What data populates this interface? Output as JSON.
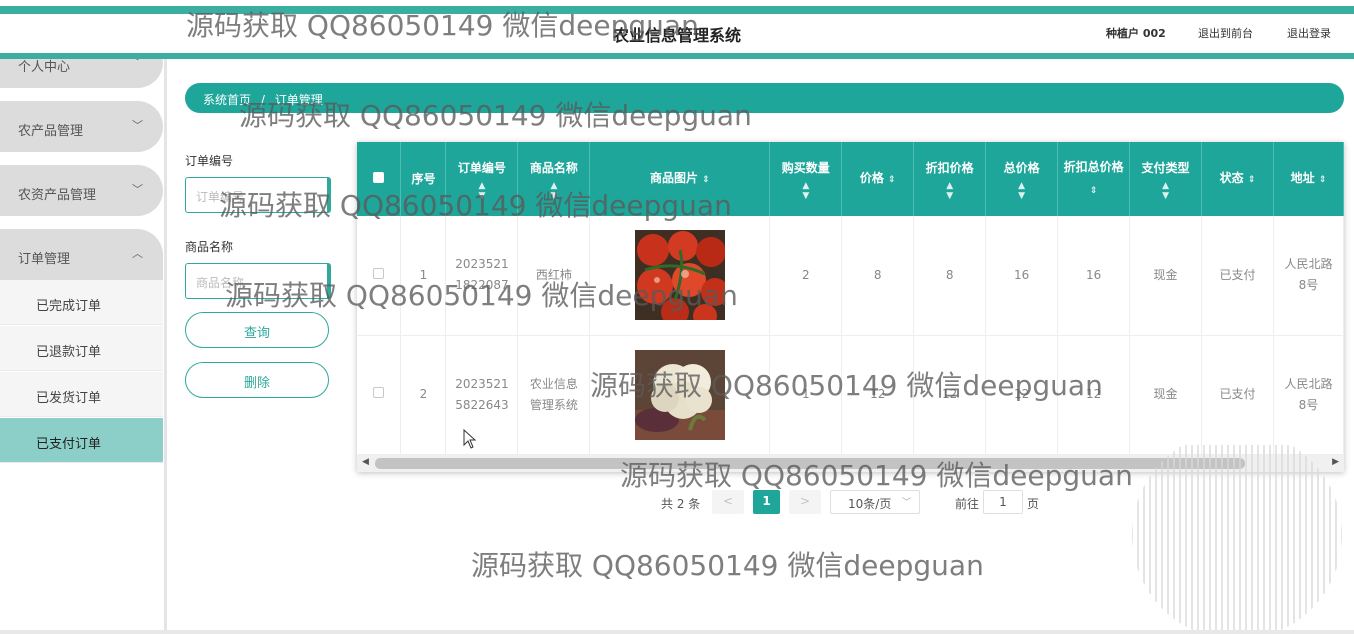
{
  "header": {
    "title": "农业信息管理系统",
    "user": "种植户 002",
    "links": [
      "退出到前台",
      "退出登录"
    ]
  },
  "sidebar": {
    "items": [
      {
        "label": "个人中心",
        "expanded": false
      },
      {
        "label": "农产品管理",
        "expanded": false
      },
      {
        "label": "农资产品管理",
        "expanded": false
      },
      {
        "label": "订单管理",
        "expanded": true
      }
    ],
    "subitems": [
      "已完成订单",
      "已退款订单",
      "已发货订单",
      "已支付订单"
    ],
    "active_subitem": "已支付订单"
  },
  "breadcrumb": {
    "home": "系统首页",
    "separator": "/",
    "current": "订单管理"
  },
  "filters": {
    "order_no_label": "订单编号",
    "order_no_placeholder": "订单编号",
    "product_label": "商品名称",
    "product_placeholder": "商品名称",
    "query_button": "查询",
    "delete_button": "删除"
  },
  "table": {
    "columns": [
      "序号",
      "订单编号",
      "商品名称",
      "商品图片",
      "购买数量",
      "价格",
      "折扣价格",
      "总价格",
      "折扣总价格",
      "支付类型",
      "状态",
      "地址"
    ],
    "rows": [
      {
        "index": "1",
        "order_no": "20235211822087",
        "order_no_lines": [
          "2023521",
          "1822087"
        ],
        "product": "西红柿",
        "product_lines": [
          "西红柿"
        ],
        "image": "tomato-image",
        "qty": "2",
        "price": "8",
        "discount_price": "8",
        "total": "16",
        "discount_total": "16",
        "pay_type": "现金",
        "status": "已支付",
        "address_lines": [
          "人民北路",
          "8号"
        ]
      },
      {
        "index": "2",
        "order_no": "20235215822643",
        "order_no_lines": [
          "2023521",
          "5822643"
        ],
        "product": "农业信息管理系统",
        "product_lines": [
          "农业信息",
          "管理系统"
        ],
        "image": "cauliflower-image",
        "qty": "1",
        "price": "12",
        "discount_price": "12",
        "total": "12",
        "discount_total": "12",
        "pay_type": "现金",
        "status": "已支付",
        "address_lines": [
          "人民北路",
          "8号"
        ]
      }
    ]
  },
  "pagination": {
    "total_text": "共 2 条",
    "prev": "<",
    "current_page": "1",
    "next": ">",
    "page_size": "10条/页",
    "goto_label": "前往",
    "goto_value": "1",
    "page_suffix": "页"
  },
  "watermark": "源码获取 QQ86050149 微信deepguan",
  "colors": {
    "primary": "#1fa69b",
    "sidebar_active": "#8ccfc8",
    "menu_pill": "#dcdcdc"
  }
}
